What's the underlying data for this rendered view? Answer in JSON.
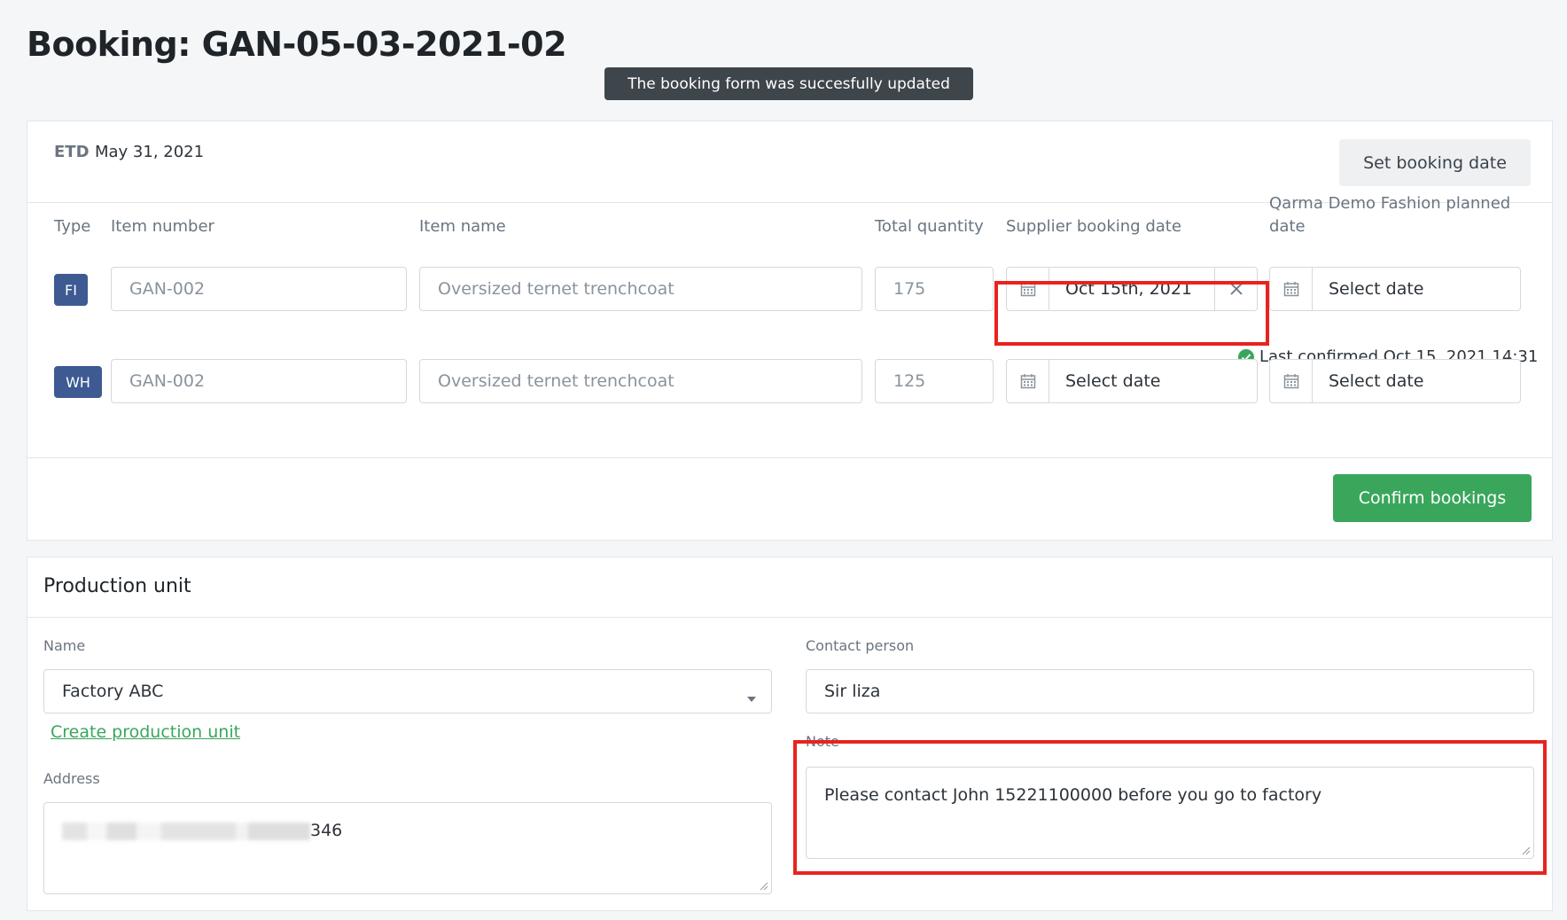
{
  "page": {
    "title": "Booking: GAN-05-03-2021-02",
    "toast": "The booking form was succesfully updated"
  },
  "etd": {
    "label": "ETD",
    "value": "May 31, 2021"
  },
  "set_booking_button": "Set booking date",
  "columns": {
    "type": "Type",
    "item_number": "Item number",
    "item_name": "Item name",
    "total_quantity": "Total quantity",
    "supplier_booking_date": "Supplier booking date",
    "planned_date_line1": "Qarma Demo Fashion planned",
    "planned_date_line2": "date"
  },
  "rows": [
    {
      "type": "FI",
      "item_number": "GAN-002",
      "item_name": "Oversized ternet trenchcoat",
      "quantity": "175",
      "supplier_date": "Oct 15th, 2021",
      "planned_date": "Select date"
    },
    {
      "type": "WH",
      "item_number": "GAN-002",
      "item_name": "Oversized ternet trenchcoat",
      "quantity": "125",
      "supplier_date": "Select date",
      "planned_date": "Select date"
    }
  ],
  "last_confirmed": "Last confirmed Oct 15, 2021 14:31",
  "confirm_button": "Confirm bookings",
  "production_unit": {
    "title": "Production unit",
    "name_label": "Name",
    "name_value": "Factory ABC",
    "create_link": "Create production unit",
    "address_label": "Address",
    "address_value_visible": "346",
    "contact_label": "Contact person",
    "contact_value": "Sir liza",
    "note_label": "Note",
    "note_value": "Please contact John 15221100000 before you go to factory"
  },
  "colors": {
    "accent_green": "#3aa65c",
    "badge_blue": "#3d5a92",
    "highlight_red": "#e8231f",
    "toast_bg": "#3e454b"
  }
}
